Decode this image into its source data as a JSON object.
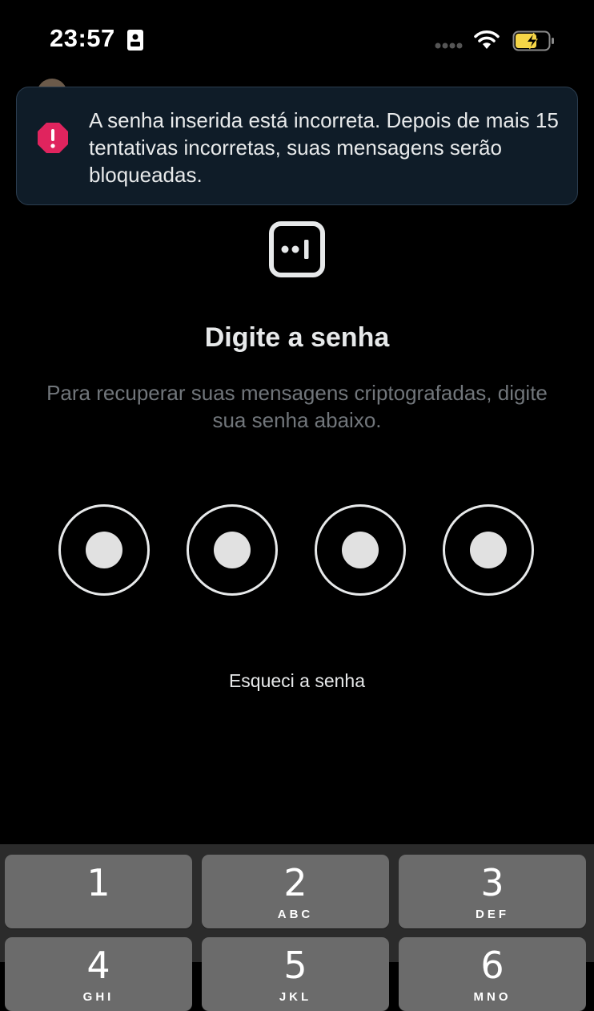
{
  "status_bar": {
    "time": "23:57",
    "icons": [
      "id-card-icon",
      "cellular-signal-icon",
      "wifi-icon",
      "battery-charging-icon"
    ],
    "battery_color": "#f5d547"
  },
  "toast": {
    "icon": "alert-octagon-icon",
    "icon_color": "#e0245e",
    "message": "A senha inserida está incorreta. Depois de mais 15 tentativas incorretas, suas mensagens serão bloqueadas."
  },
  "main": {
    "icon": "passcode-lock-icon",
    "title": "Digite a senha",
    "subtitle": "Para recuperar suas mensagens criptografadas, digite sua senha abaixo.",
    "pin": {
      "length": 4,
      "filled": 4
    },
    "forgot_link": "Esqueci a senha"
  },
  "keypad": {
    "keys": [
      {
        "num": "1",
        "letters": ""
      },
      {
        "num": "2",
        "letters": "ABC"
      },
      {
        "num": "3",
        "letters": "DEF"
      },
      {
        "num": "4",
        "letters": "GHI"
      },
      {
        "num": "5",
        "letters": "JKL"
      },
      {
        "num": "6",
        "letters": "MNO"
      }
    ]
  },
  "colors": {
    "background": "#000000",
    "toast_background": "#0f1c28",
    "text_primary": "#e7e9ea",
    "text_secondary": "#71767b",
    "key_background": "#6b6b6b"
  }
}
